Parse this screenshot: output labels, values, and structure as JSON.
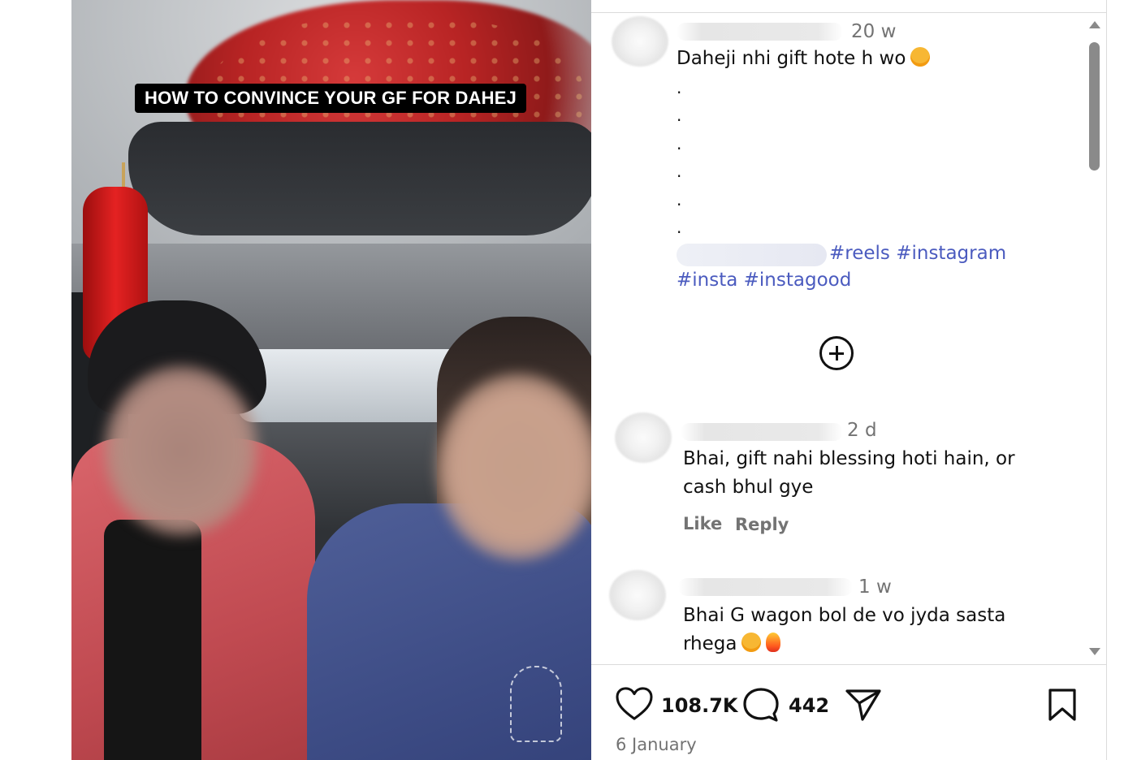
{
  "video": {
    "caption": "HOW TO CONVINCE YOUR GF FOR DAHEJ"
  },
  "post": {
    "time": "20 w",
    "text": "Daheji nhi gift hote h wo",
    "dots": [
      ".",
      ".",
      ".",
      ".",
      ".",
      "."
    ],
    "hashtags_line1": "#reels #instagram",
    "hashtags_line2": "#insta #instagood"
  },
  "comments": [
    {
      "time": "2 d",
      "text_line1": "Bhai, gift nahi blessing hoti hain, or",
      "text_line2": "cash bhul gye",
      "like_label": "Like",
      "reply_label": "Reply"
    },
    {
      "time": "1 w",
      "text_line1": "Bhai G wagon bol de vo jyda sasta",
      "text_line2": "rhega"
    }
  ],
  "actions": {
    "likes": "108.7K",
    "comments": "442",
    "date": "6 January",
    "icons": [
      "heart-icon",
      "comment-icon",
      "share-icon",
      "bookmark-icon"
    ]
  },
  "colors": {
    "hashtag": "#4b5bbf",
    "muted": "#737373",
    "text": "#111111"
  }
}
